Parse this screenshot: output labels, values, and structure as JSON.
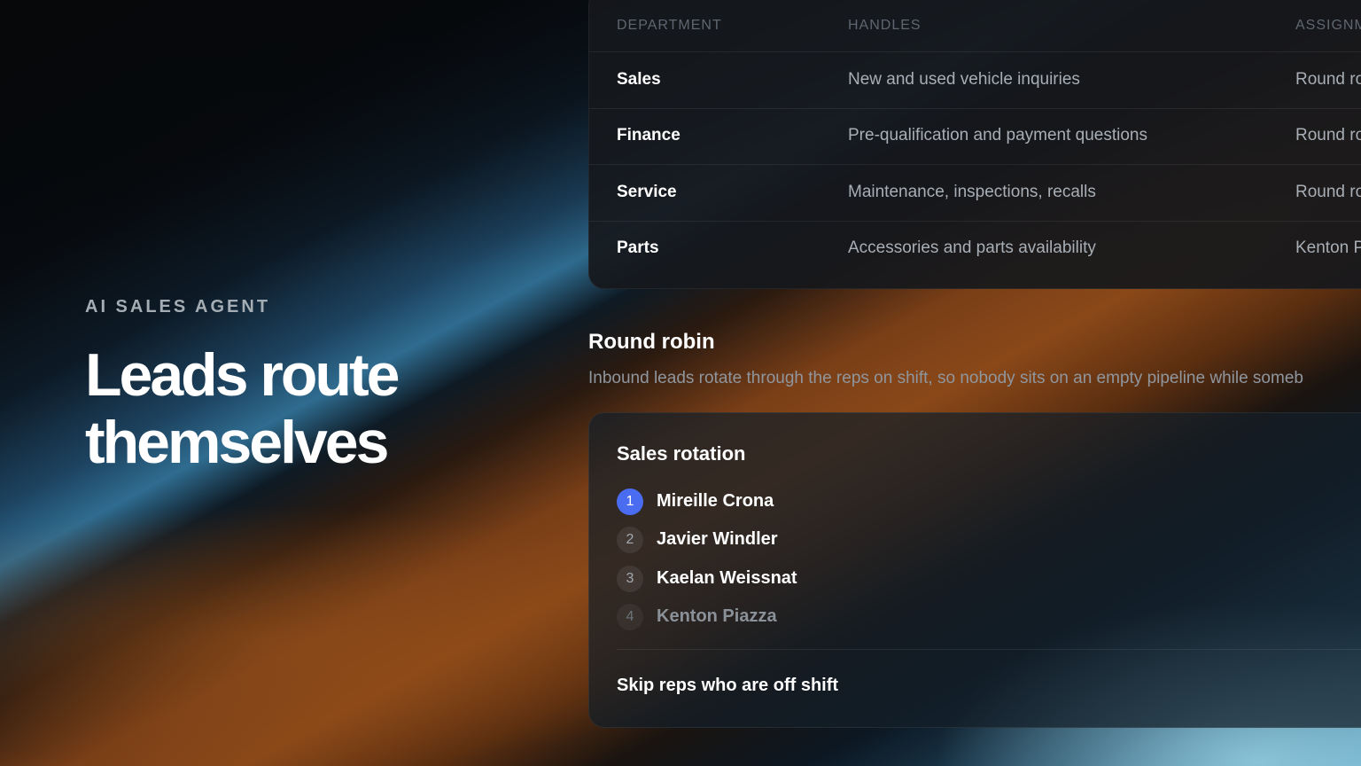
{
  "hero": {
    "eyebrow": "AI SALES AGENT",
    "headline_line1": "Leads route",
    "headline_line2": "themselves"
  },
  "departments": {
    "headers": [
      "DEPARTMENT",
      "HANDLES",
      "ASSIGNM"
    ],
    "rows": [
      {
        "department": "Sales",
        "handles": "New and used vehicle inquiries",
        "assignment": "Round ro"
      },
      {
        "department": "Finance",
        "handles": "Pre-qualification and payment questions",
        "assignment": "Round ro"
      },
      {
        "department": "Service",
        "handles": "Maintenance, inspections, recalls",
        "assignment": "Round ro"
      },
      {
        "department": "Parts",
        "handles": "Accessories and parts availability",
        "assignment": "Kenton P"
      }
    ]
  },
  "round_robin": {
    "title": "Round robin",
    "description": "Inbound leads rotate through the reps on shift, so nobody sits on an empty pipeline while someb"
  },
  "rotation": {
    "title": "Sales rotation",
    "reps": [
      {
        "number": "1",
        "name": "Mireille Crona"
      },
      {
        "number": "2",
        "name": "Javier Windler"
      },
      {
        "number": "3",
        "name": "Kaelan Weissnat"
      },
      {
        "number": "4",
        "name": "Kenton Piazza"
      }
    ],
    "skip_label": "Skip reps who are off shift"
  },
  "colors": {
    "accent": "#4a6cf0",
    "card_bg": "#16181c",
    "muted_text": "#a8aeb5"
  }
}
